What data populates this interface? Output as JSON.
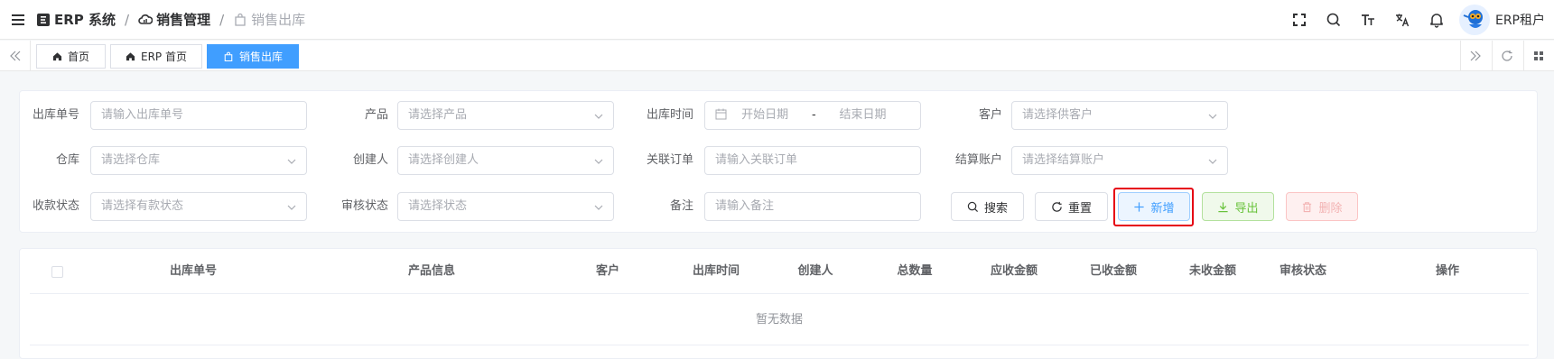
{
  "breadcrumb": {
    "root": "ERP 系统",
    "section": "销售管理",
    "current": "销售出库"
  },
  "user": {
    "name": "ERP租户"
  },
  "tabs": [
    {
      "label": "首页"
    },
    {
      "label": "ERP 首页"
    },
    {
      "label": "销售出库",
      "active": true
    }
  ],
  "filters": {
    "outbound_no": {
      "label": "出库单号",
      "placeholder": "请输入出库单号"
    },
    "product": {
      "label": "产品",
      "placeholder": "请选择产品"
    },
    "outbound_time": {
      "label": "出库时间",
      "start_placeholder": "开始日期",
      "separator": "-",
      "end_placeholder": "结束日期"
    },
    "customer": {
      "label": "客户",
      "placeholder": "请选择供客户"
    },
    "warehouse": {
      "label": "仓库",
      "placeholder": "请选择仓库"
    },
    "creator": {
      "label": "创建人",
      "placeholder": "请选择创建人"
    },
    "related_order": {
      "label": "关联订单",
      "placeholder": "请输入关联订单"
    },
    "settlement_account": {
      "label": "结算账户",
      "placeholder": "请选择结算账户"
    },
    "payment_status": {
      "label": "收款状态",
      "placeholder": "请选择有款状态"
    },
    "audit_status": {
      "label": "审核状态",
      "placeholder": "请选择状态"
    },
    "remark": {
      "label": "备注",
      "placeholder": "请输入备注"
    }
  },
  "buttons": {
    "search": "搜索",
    "reset": "重置",
    "add": "新增",
    "export": "导出",
    "delete": "删除"
  },
  "table": {
    "columns": [
      "出库单号",
      "产品信息",
      "客户",
      "出库时间",
      "创建人",
      "总数量",
      "应收金额",
      "已收金额",
      "未收金额",
      "审核状态",
      "操作"
    ],
    "empty_text": "暂无数据"
  },
  "colors": {
    "primary": "#409eff",
    "success": "#67c23a",
    "danger": "#f56c6c",
    "highlight_frame": "#e60012"
  }
}
